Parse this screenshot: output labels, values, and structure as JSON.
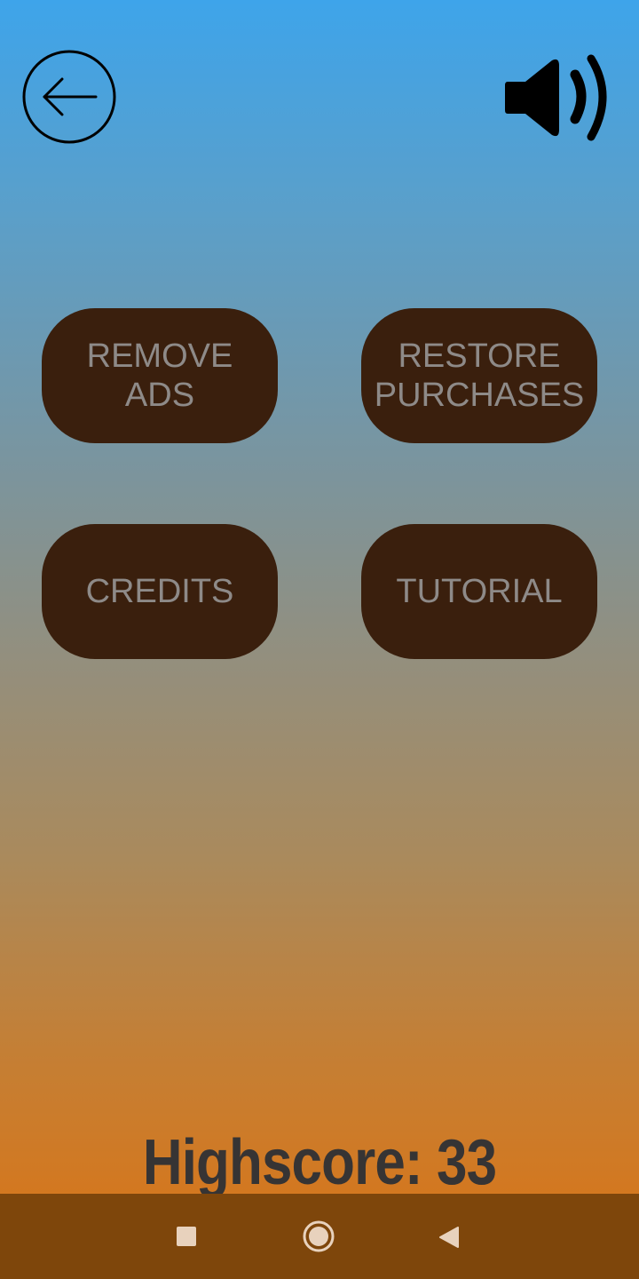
{
  "header": {
    "back_icon": "arrow-left-circle-icon",
    "sound_icon": "speaker-volume-icon"
  },
  "menu": {
    "remove_ads_label": "REMOVE\nADS",
    "restore_purchases_label": "RESTORE\nPURCHASES",
    "credits_label": "CREDITS",
    "tutorial_label": "TUTORIAL"
  },
  "footer": {
    "highscore_text": "Highscore: 33"
  },
  "navigation_bar": {
    "recents_icon": "square-icon",
    "home_icon": "circle-icon",
    "back_icon": "triangle-back-icon"
  },
  "colors": {
    "button_bg": "#3a1f0d",
    "button_text": "#8e8a88",
    "nav_bar_bg": "#7e460b",
    "highscore_text": "#363434"
  }
}
